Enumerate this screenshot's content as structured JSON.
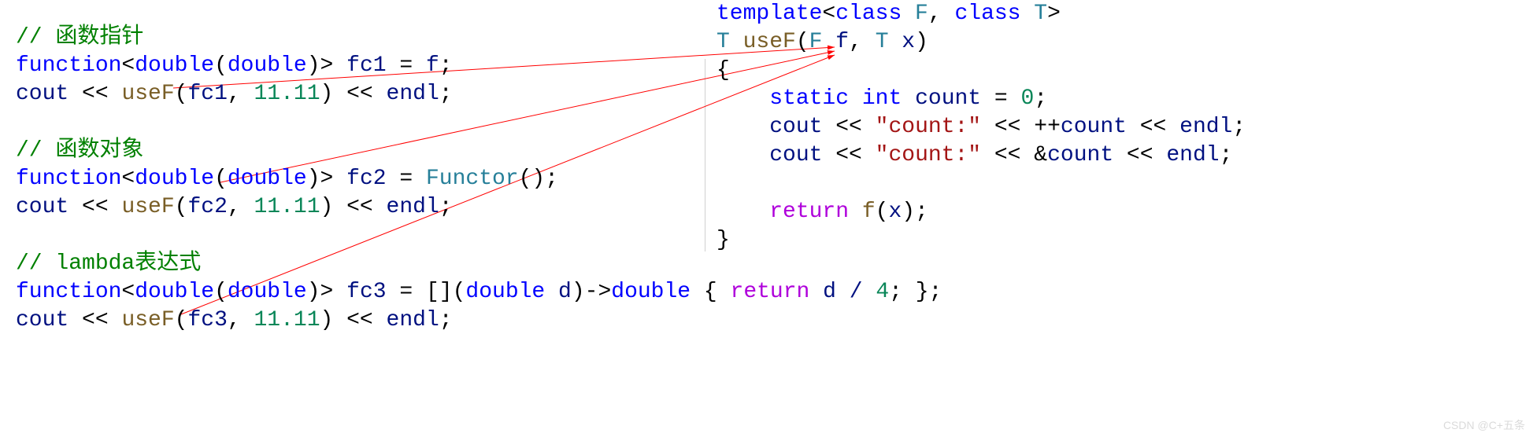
{
  "left": {
    "comment1": "// 函数指针",
    "l1": {
      "function": "function",
      "lt": "<",
      "double1": "double",
      "lp": "(",
      "double2": "double",
      "rp": ")",
      "gt": ">",
      "sp": " ",
      "var": "fc1",
      "eq": " = ",
      "rhs": "f",
      "semi": ";"
    },
    "l2": {
      "cout": "cout",
      "ins1": " << ",
      "useF": "useF",
      "lp": "(",
      "arg1": "fc1",
      "comma": ", ",
      "num": "11.11",
      "rp": ")",
      "ins2": " << ",
      "endl": "endl",
      "semi": ";"
    },
    "comment2": "// 函数对象",
    "l3": {
      "function": "function",
      "lt": "<",
      "double1": "double",
      "lp": "(",
      "double2": "double",
      "rp": ")",
      "gt": ">",
      "sp": " ",
      "var": "fc2",
      "eq": " = ",
      "functor": "Functor",
      "paren": "()",
      "semi": ";"
    },
    "l4": {
      "cout": "cout",
      "ins1": " << ",
      "useF": "useF",
      "lp": "(",
      "arg1": "fc2",
      "comma": ", ",
      "num": "11.11",
      "rp": ")",
      "ins2": " << ",
      "endl": "endl",
      "semi": ";"
    },
    "comment3": "// lambda表达式",
    "l5": {
      "function": "function",
      "lt": "<",
      "double1": "double",
      "lp": "(",
      "double2": "double",
      "rp": ")",
      "gt": ">",
      "sp": " ",
      "var": "fc3",
      "eq": " = ",
      "cap": "[]",
      "lp2": "(",
      "ptype": "double",
      "pname": " d",
      "rp2": ")",
      "arrow": "->",
      "rtype": "double",
      "body_open": " { ",
      "ret": "return",
      "expr": " d / ",
      "four": "4",
      "semi_in": ";",
      "body_close": " }",
      "semi": ";"
    },
    "l6": {
      "cout": "cout",
      "ins1": " << ",
      "useF": "useF",
      "lp": "(",
      "arg1": "fc3",
      "comma": ", ",
      "num": "11.11",
      "rp": ")",
      "ins2": " << ",
      "endl": "endl",
      "semi": ";"
    }
  },
  "right": {
    "r1": {
      "template": "template",
      "lt": "<",
      "class1": "class",
      "F": " F",
      "comma": ", ",
      "class2": "class",
      "T": " T",
      "gt": ">"
    },
    "r2": {
      "T": "T",
      "sp": " ",
      "useF": "useF",
      "lp": "(",
      "F": "F",
      "f": " f",
      "comma": ", ",
      "T2": "T",
      "x": " x",
      "rp": ")"
    },
    "r3": "{",
    "r4": {
      "indent": "    ",
      "static": "static",
      "sp1": " ",
      "int": "int",
      "sp2": " ",
      "count": "count",
      "eq": " = ",
      "zero": "0",
      "semi": ";"
    },
    "r5": {
      "indent": "    ",
      "cout": "cout",
      "ins1": " << ",
      "str": "\"count:\"",
      "ins2": " << ",
      "pp": "++",
      "count": "count",
      "ins3": " << ",
      "endl": "endl",
      "semi": ";"
    },
    "r6": {
      "indent": "    ",
      "cout": "cout",
      "ins1": " << ",
      "str": "\"count:\"",
      "ins2": " << ",
      "amp": "&",
      "count": "count",
      "ins3": " << ",
      "endl": "endl",
      "semi": ";"
    },
    "r7": {
      "indent": "    ",
      "ret": "return",
      "sp": " ",
      "f": "f",
      "lp": "(",
      "x": "x",
      "rp": ")",
      "semi": ";"
    },
    "r8": "}"
  },
  "watermark": "CSDN @C+五条"
}
